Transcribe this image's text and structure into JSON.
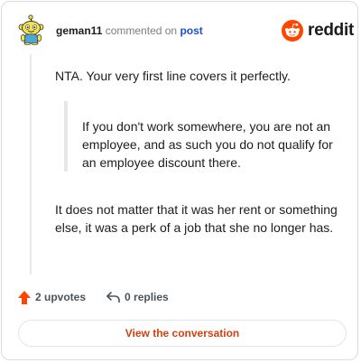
{
  "header": {
    "username": "geman11",
    "action_text": "commented on",
    "post_link": "post",
    "brand_name": "reddit",
    "brand_color": "#ff4500"
  },
  "comment": {
    "paragraph1": "NTA. Your very first line covers it perfectly.",
    "quote": "If you don't work somewhere, you are not an employee, and as such you do not qualify for an employee discount there.",
    "paragraph2": "It does not matter that it was her rent or something else, it was a perk of a job that she no longer has."
  },
  "actions": {
    "upvotes_label": "2 upvotes",
    "replies_label": "0 replies",
    "upvote_icon": "upvote-arrow-icon",
    "reply_icon": "reply-arrow-icon",
    "upvote_color": "#ff4500"
  },
  "cta": {
    "label": "View the conversation",
    "color": "#d43f0d"
  }
}
